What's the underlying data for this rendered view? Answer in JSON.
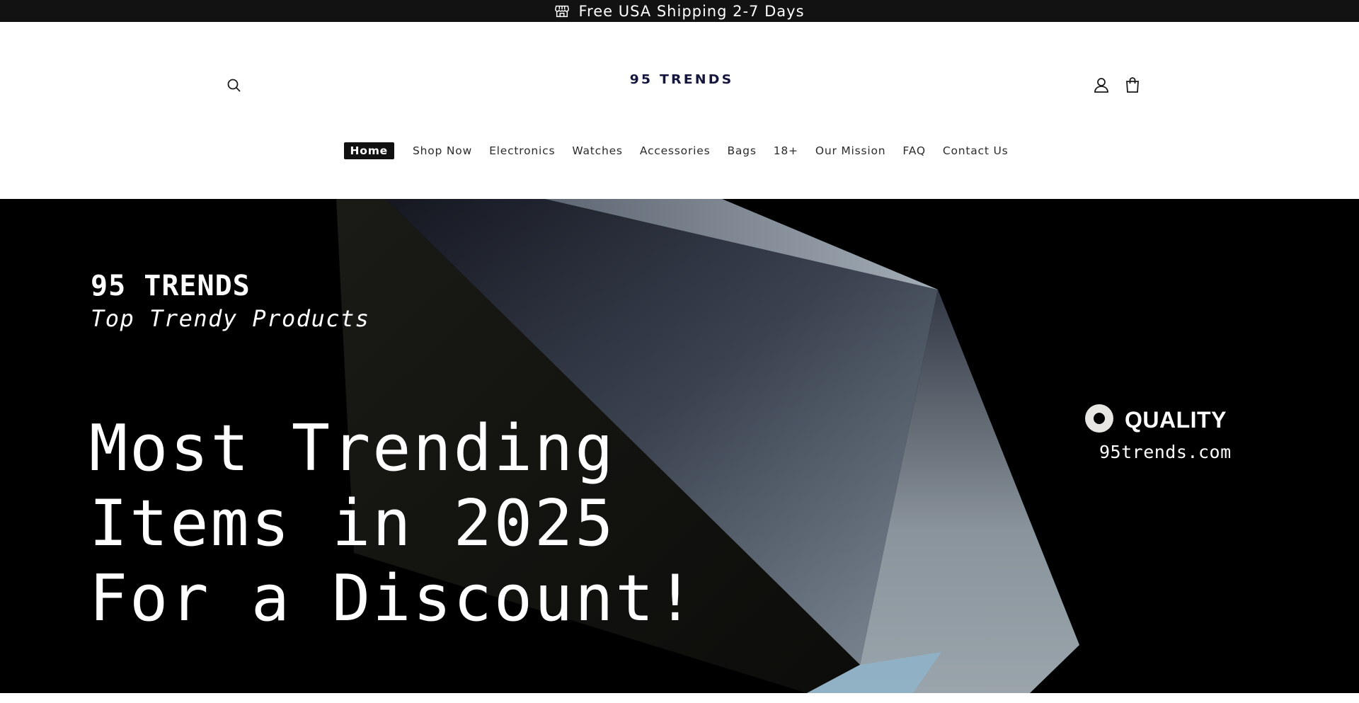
{
  "announcement": {
    "icon": "storefront-icon",
    "text": "Free USA Shipping 2-7 Days"
  },
  "header": {
    "logo_text": "95 TRENDS",
    "logo_color": "#15163d",
    "search_icon": "search-icon",
    "account_icon": "account-icon",
    "cart_icon": "cart-bag-icon"
  },
  "nav": {
    "items": [
      {
        "label": "Home",
        "active": true
      },
      {
        "label": "Shop Now"
      },
      {
        "label": "Electronics"
      },
      {
        "label": "Watches"
      },
      {
        "label": "Accessories"
      },
      {
        "label": "Bags"
      },
      {
        "label": "18+"
      },
      {
        "label": "Our Mission"
      },
      {
        "label": "FAQ"
      },
      {
        "label": "Contact Us"
      }
    ]
  },
  "hero": {
    "brand": "95 TRENDS",
    "tagline": "Top Trendy Products",
    "headline_lines": [
      "Most Trending",
      "Items in 2025",
      "For a Discount!"
    ],
    "quality_label": "QUALITY",
    "quality_url": "95trends.com",
    "background_color": "#000000"
  },
  "colors": {
    "announcement_bg": "#121212",
    "nav_active_bg": "#111111",
    "text_dark": "#2b2b2b"
  }
}
